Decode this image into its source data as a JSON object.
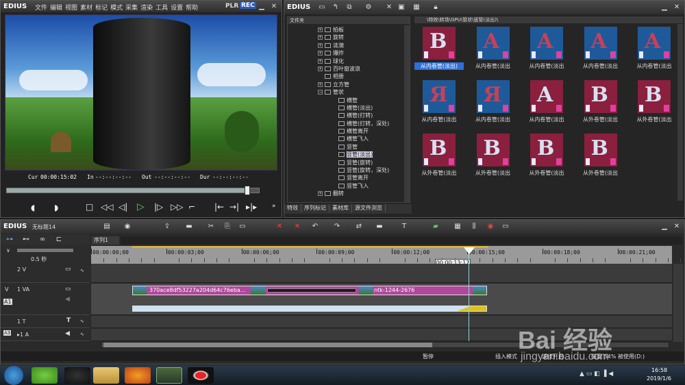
{
  "player": {
    "brand": "EDIUS",
    "menu": [
      "文件",
      "编辑",
      "视图",
      "素材",
      "标记",
      "模式",
      "采集",
      "渲染",
      "工具",
      "设置",
      "帮助"
    ],
    "plr": "PLR",
    "rec": "REC",
    "cur_label": "Cur",
    "cur_value": "00:00:15:02",
    "in_label": "In",
    "in_value": "--:--:--:--",
    "out_label": "Out",
    "out_value": "--:--:--:--",
    "dur_label": "Dur",
    "dur_value": "--:--:--:--"
  },
  "library": {
    "brand": "EDIUS",
    "folder_header": "文件夹",
    "path": "\\特效\\转场\\GPU\\管状\\竖管(淡出)\\",
    "tree": [
      {
        "label": "拍板",
        "indent": 0,
        "type": "plus"
      },
      {
        "label": "旋转",
        "indent": 0,
        "type": "plus"
      },
      {
        "label": "涟漪",
        "indent": 0,
        "type": "plus"
      },
      {
        "label": "爆炸",
        "indent": 0,
        "type": "plus"
      },
      {
        "label": "球化",
        "indent": 0,
        "type": "plus"
      },
      {
        "label": "百叶窗波浪",
        "indent": 0,
        "type": "plus"
      },
      {
        "label": "相册",
        "indent": 0,
        "type": "none"
      },
      {
        "label": "立方管",
        "indent": 0,
        "type": "plus"
      },
      {
        "label": "管状",
        "indent": 0,
        "type": "minus"
      },
      {
        "label": "横管",
        "indent": 1,
        "type": "item"
      },
      {
        "label": "横管(淡出)",
        "indent": 1,
        "type": "item"
      },
      {
        "label": "横管(打转)",
        "indent": 1,
        "type": "item"
      },
      {
        "label": "横管(打转，深处)",
        "indent": 1,
        "type": "item"
      },
      {
        "label": "横管离开",
        "indent": 1,
        "type": "item"
      },
      {
        "label": "横管飞入",
        "indent": 1,
        "type": "item"
      },
      {
        "label": "竖管",
        "indent": 1,
        "type": "item"
      },
      {
        "label": "竖管(淡出)",
        "indent": 1,
        "type": "item",
        "selected": true
      },
      {
        "label": "竖管(旋转)",
        "indent": 1,
        "type": "item"
      },
      {
        "label": "竖管(旋转，深处)",
        "indent": 1,
        "type": "item"
      },
      {
        "label": "竖管离开",
        "indent": 1,
        "type": "item"
      },
      {
        "label": "竖管飞入",
        "indent": 1,
        "type": "item"
      },
      {
        "label": "翻转",
        "indent": 0,
        "type": "plus"
      }
    ],
    "tabs": [
      "特效",
      "序列标记",
      "素材库",
      "源文件浏览"
    ],
    "thumbnails": [
      {
        "caption": "从内卷管(淡出)",
        "letter": "B",
        "style": "red",
        "selected": true
      },
      {
        "caption": "从内卷管(淡出",
        "letter": "A",
        "style": "blue"
      },
      {
        "caption": "从内卷管(淡出",
        "letter": "A",
        "style": "blue"
      },
      {
        "caption": "从内卷管(淡出",
        "letter": "A",
        "style": "blue"
      },
      {
        "caption": "从内卷管(淡出",
        "letter": "A",
        "style": "blue"
      },
      {
        "caption": "从内卷管(淡出",
        "letter": "Я",
        "style": "blue"
      },
      {
        "caption": "从内卷管(淡出",
        "letter": "Я",
        "style": "blue"
      },
      {
        "caption": "从内卷管(淡出",
        "letter": "A",
        "style": "red"
      },
      {
        "caption": "从外卷管(淡出",
        "letter": "B",
        "style": "red"
      },
      {
        "caption": "从外卷管(淡出",
        "letter": "B",
        "style": "red"
      },
      {
        "caption": "从外卷管(淡出",
        "letter": "B",
        "style": "red"
      },
      {
        "caption": "从外卷管(淡出",
        "letter": "B",
        "style": "red"
      },
      {
        "caption": "从外卷管(淡出",
        "letter": "B",
        "style": "red"
      },
      {
        "caption": "从外卷管(淡出",
        "letter": "B",
        "style": "red"
      }
    ]
  },
  "timeline": {
    "brand": "EDIUS",
    "project": "无标题14",
    "sequence_tab": "序列1",
    "zoom": "0.5 秒",
    "ruler": [
      "00:00:00;00",
      "00:00:03;00",
      "00:00:06;00",
      "00:00:09;00",
      "00:00:12;00",
      "00:00:15;00",
      "00:00:18;00",
      "00:00:21;00"
    ],
    "playhead_tooltip": "00:00:13:17",
    "tracks": [
      {
        "name": "2 V",
        "type": "v"
      },
      {
        "name": "1 VA",
        "type": "va"
      },
      {
        "name": "1 T",
        "type": "t"
      },
      {
        "name": "▸1 A",
        "type": "a"
      }
    ],
    "clip1_name": "370ace8df53227a204d64c76eba...",
    "clip2_name": "ntk-1244-2676",
    "status": [
      "暂停",
      "插入模式",
      "波纹开启",
      "磁盘:54% 被使用(D:)"
    ]
  },
  "taskbar": {
    "time": "16:58",
    "date": "2019/1/6"
  },
  "watermark": {
    "brand": "Bai 经验",
    "url": "jingyan.baidu.com"
  },
  "colors": {
    "accent_blue": "#2a5ab8",
    "clip_magenta": "#b0489c",
    "audio_blue": "#cfe2f2",
    "selection": "#2f6fd6"
  }
}
